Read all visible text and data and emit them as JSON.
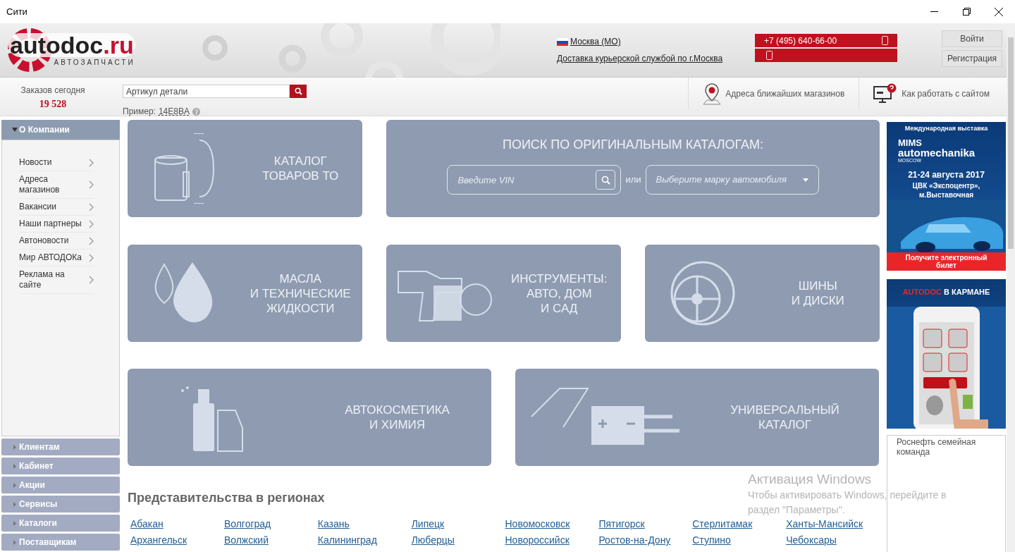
{
  "window": {
    "title": "Сити"
  },
  "header": {
    "logo": {
      "name": "autodoc",
      "tld": ".ru",
      "tagline": "АВТОЗАПЧАСТИ"
    },
    "region": "Москва (МО)",
    "delivery": "Доставка курьерской службой по г.Москва",
    "phone": "+7 (495) 640-66-00",
    "buttons": [
      "Войти",
      "Регистрация"
    ]
  },
  "subbar": {
    "orders_label": "Заказов сегодня",
    "orders_count": "19 528",
    "search": {
      "placeholder": "Артикул детали"
    },
    "example_label": "Пример:",
    "example_value": "14E8BA",
    "links": [
      {
        "kind": "map",
        "label": "Адреса ближайших магазинов"
      },
      {
        "kind": "help",
        "label": "Как работать с сайтом"
      }
    ]
  },
  "sidebar": {
    "sections": [
      {
        "label": "О Компании",
        "expanded": true,
        "children": [
          "Новости",
          "Адреса магазинов",
          "Вакансии",
          "Наши партнеры",
          "Автоновости",
          "Мир АВТОДОКа",
          "Реклама на сайте"
        ]
      },
      {
        "label": "Клиентам",
        "expanded": false
      },
      {
        "label": "Кабинет",
        "expanded": false
      },
      {
        "label": "Акции",
        "expanded": false
      },
      {
        "label": "Сервисы",
        "expanded": false
      },
      {
        "label": "Каталоги",
        "expanded": false
      },
      {
        "label": "Поставщикам",
        "expanded": false
      }
    ]
  },
  "tiles": [
    {
      "kind": "filter",
      "lines": [
        "КАТАЛОГ",
        "ТОВАРОВ ТО"
      ]
    },
    {
      "kind": "search",
      "title": "ПОИСК ПО ОРИГИНАЛЬНЫМ КАТАЛОГАМ:",
      "vin_placeholder": "Введите VIN",
      "or": "или",
      "brand_placeholder": "Выберите марку автомобиля"
    },
    {
      "kind": "oil",
      "lines": [
        "МАСЛА",
        "И ТЕХНИЧЕСКИЕ",
        "ЖИДКОСТИ"
      ]
    },
    {
      "kind": "tools",
      "lines": [
        "ИНСТРУМЕНТЫ:",
        "АВТО, ДОМ",
        "И САД"
      ]
    },
    {
      "kind": "tires",
      "lines": [
        "ШИНЫ",
        "И ДИСКИ"
      ]
    },
    {
      "kind": "cosmetics",
      "lines": [
        "АВТОКОСМЕТИКА",
        "И ХИМИЯ"
      ]
    },
    {
      "kind": "universal",
      "lines": [
        "УНИВЕРСАЛЬНЫЙ",
        "КАТАЛОГ"
      ]
    }
  ],
  "regions": {
    "title": "Представительства в регионах",
    "cities": [
      [
        "Абакан",
        "Архангельск"
      ],
      [
        "Волгоград",
        "Волжский"
      ],
      [
        "Казань",
        "Калининград"
      ],
      [
        "Липецк",
        "Люберцы"
      ],
      [
        "Новомосковск",
        "Новороссийск"
      ],
      [
        "Пятигорск",
        "Ростов-на-Дону"
      ],
      [
        "Стерлитамак",
        "Ступино"
      ],
      [
        "Ханты-Мансийск",
        "Чебоксары"
      ]
    ]
  },
  "banners": [
    {
      "kind": "expo",
      "lines": [
        "Международная выставка",
        "MIMS",
        "automechanika",
        "MOSCOW",
        "21-24 августа 2017",
        "ЦВК «Экспоцентр»,",
        "м.Выставочная"
      ],
      "cta": "Получите электронный билет"
    },
    {
      "kind": "app",
      "brand": "AUTODOC",
      "title": "В КАРМАНЕ"
    }
  ],
  "news": "Роснефть семейная команда",
  "activation": {
    "title": "Активация Windows",
    "text": "Чтобы активировать Windows, перейдите в раздел \"Параметры\"."
  }
}
